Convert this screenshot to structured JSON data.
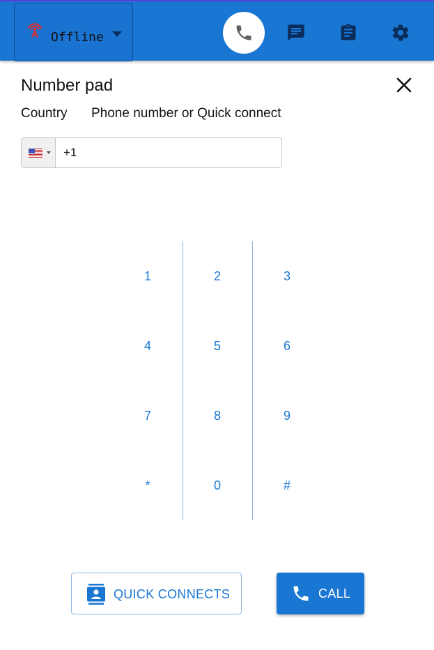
{
  "topbar": {
    "status": {
      "label": "Offline",
      "icon": "antenna-icon",
      "icon_color": "#d32f2f"
    },
    "nav": [
      {
        "name": "phone",
        "icon": "phone-icon",
        "active": true
      },
      {
        "name": "chat",
        "icon": "chat-icon"
      },
      {
        "name": "tasks",
        "icon": "clipboard-icon"
      },
      {
        "name": "settings",
        "icon": "gear-icon"
      }
    ],
    "colors": {
      "bar": "#1976d2",
      "icon": "#0b2d5c"
    }
  },
  "panel": {
    "title": "Number pad",
    "country_label": "Country",
    "phone_label": "Phone number or Quick connect",
    "country_flag": "US",
    "phone_value": "+1"
  },
  "keypad": {
    "keys": [
      "1",
      "2",
      "3",
      "4",
      "5",
      "6",
      "7",
      "8",
      "9",
      "*",
      "0",
      "#"
    ],
    "accent": "#1976d2"
  },
  "actions": {
    "quick_connects": "QUICK CONNECTS",
    "call": "CALL"
  }
}
